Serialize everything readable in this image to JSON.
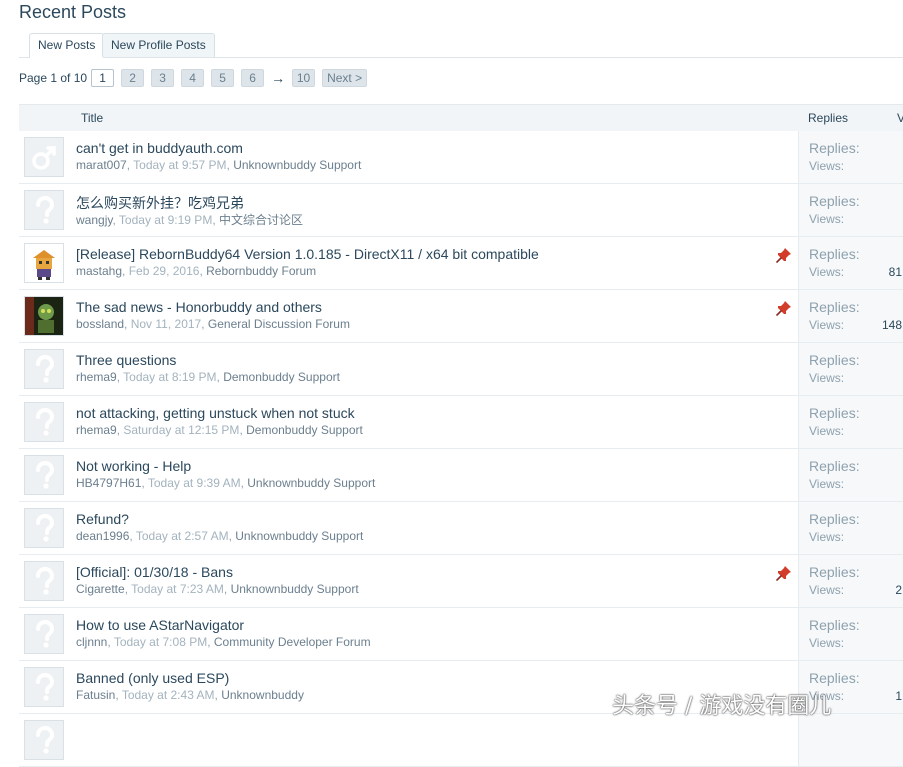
{
  "page": {
    "title": "Recent Posts"
  },
  "tabs": [
    {
      "label": "New Posts",
      "active": true
    },
    {
      "label": "New Profile Posts",
      "active": false
    }
  ],
  "pagination": {
    "label": "Page 1 of 10",
    "pages": [
      "1",
      "2",
      "3",
      "4",
      "5",
      "6"
    ],
    "current": "1",
    "arrow": "→",
    "last": "10",
    "next": "Next >"
  },
  "table": {
    "headers": {
      "title": "Title",
      "replies": "Replies",
      "views": "V"
    },
    "rows": [
      {
        "avatar": "male-icon",
        "title": "can't get in buddyauth.com",
        "author": "marat007",
        "date": "Today at 9:57 PM",
        "forum": "Unknownbuddy Support",
        "sticky": false,
        "replies_label": "Replies:",
        "views_label": "Views:",
        "views": ""
      },
      {
        "avatar": "default-avatar-icon",
        "title": "怎么购买新外挂？吃鸡兄弟",
        "author": "wangjy",
        "date": "Today at 9:19 PM",
        "forum": "中文综合讨论区",
        "sticky": false,
        "replies_label": "Replies:",
        "views_label": "Views:",
        "views": ""
      },
      {
        "avatar": "robot-avatar-icon",
        "title": "[Release] RebornBuddy64 Version 1.0.185 - DirectX11 / x64 bit compatible",
        "author": "mastahg",
        "date": "Feb 29, 2016",
        "forum": "Rebornbuddy Forum",
        "sticky": true,
        "replies_label": "Replies:",
        "views_label": "Views:",
        "views": "81"
      },
      {
        "avatar": "zombie-avatar-icon",
        "title": "The sad news - Honorbuddy and others",
        "author": "bossland",
        "date": "Nov 11, 2017",
        "forum": "General Discussion Forum",
        "sticky": true,
        "replies_label": "Replies:",
        "views_label": "Views:",
        "views": "148"
      },
      {
        "avatar": "default-avatar-icon",
        "title": "Three questions",
        "author": "rhema9",
        "date": "Today at 8:19 PM",
        "forum": "Demonbuddy Support",
        "sticky": false,
        "replies_label": "Replies:",
        "views_label": "Views:",
        "views": ""
      },
      {
        "avatar": "default-avatar-icon",
        "title": "not attacking, getting unstuck when not stuck",
        "author": "rhema9",
        "date": "Saturday at 12:15 PM",
        "forum": "Demonbuddy Support",
        "sticky": false,
        "replies_label": "Replies:",
        "views_label": "Views:",
        "views": ""
      },
      {
        "avatar": "default-avatar-icon",
        "title": "Not working - Help",
        "author": "HB4797H61",
        "date": "Today at 9:39 AM",
        "forum": "Unknownbuddy Support",
        "sticky": false,
        "replies_label": "Replies:",
        "views_label": "Views:",
        "views": ""
      },
      {
        "avatar": "default-avatar-icon",
        "title": "Refund?",
        "author": "dean1996",
        "date": "Today at 2:57 AM",
        "forum": "Unknownbuddy Support",
        "sticky": false,
        "replies_label": "Replies:",
        "views_label": "Views:",
        "views": ""
      },
      {
        "avatar": "default-avatar-icon",
        "title": "[Official]: 01/30/18 - Bans",
        "author": "Cigarette",
        "date": "Today at 7:23 AM",
        "forum": "Unknownbuddy Support",
        "sticky": true,
        "replies_label": "Replies:",
        "views_label": "Views:",
        "views": "2"
      },
      {
        "avatar": "default-avatar-icon",
        "title": "How to use AStarNavigator",
        "author": "cljnnn",
        "date": "Today at 7:08 PM",
        "forum": "Community Developer Forum",
        "sticky": false,
        "replies_label": "Replies:",
        "views_label": "Views:",
        "views": ""
      },
      {
        "avatar": "default-avatar-icon",
        "title": "Banned (only used ESP)",
        "author": "Fatusin",
        "date": "Today at 2:43 AM",
        "forum": "Unknownbuddy",
        "sticky": false,
        "replies_label": "Replies:",
        "views_label": "Views:",
        "views": "1"
      },
      {
        "avatar": "default-avatar-icon",
        "title": "",
        "author": "",
        "date": "",
        "forum": "",
        "sticky": false,
        "replies_label": "",
        "views_label": "",
        "views": ""
      }
    ]
  },
  "watermark": "头条号 / 游戏没有圈儿",
  "colors": {
    "link": "#2b485c",
    "muted": "#8ea1af",
    "pin": "#d23c2b",
    "header_bg": "#f2f5f7"
  }
}
